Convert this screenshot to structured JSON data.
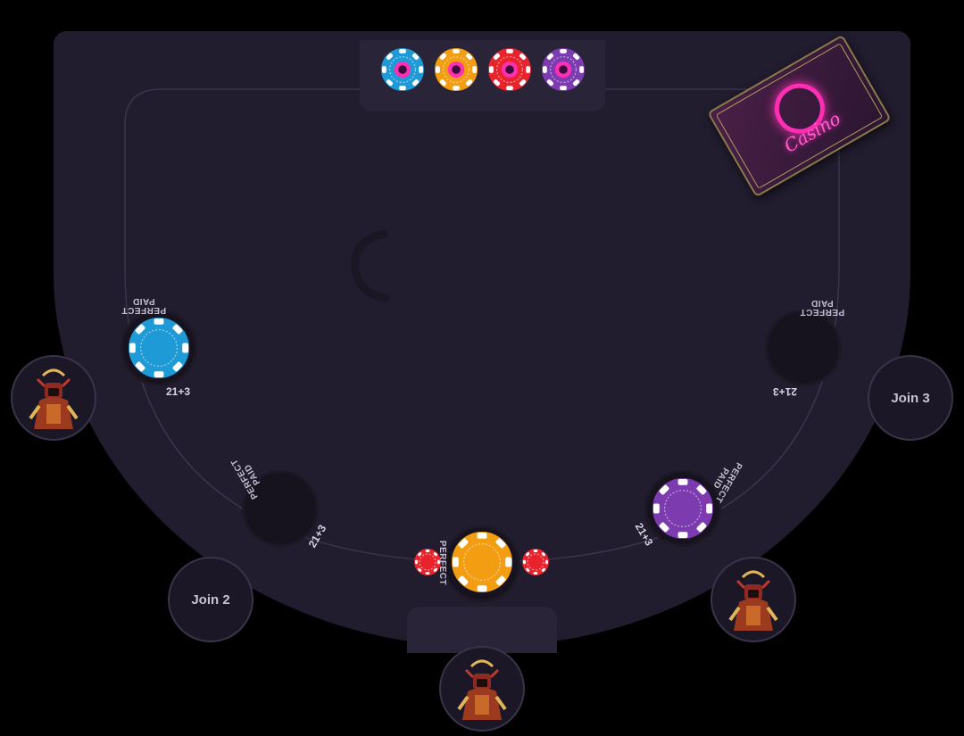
{
  "chip_tray": {
    "chips": [
      {
        "name": "chip-blue",
        "color": "#1e9ad6"
      },
      {
        "name": "chip-gold",
        "color": "#f29d12"
      },
      {
        "name": "chip-red",
        "color": "#e8232c"
      },
      {
        "name": "chip-purple",
        "color": "#7d3bb0"
      }
    ]
  },
  "seats": [
    {
      "position": "left",
      "state": "occupied",
      "avatar": "samurai-avatar"
    },
    {
      "position": "lower-left",
      "state": "open",
      "join_label": "Join 2"
    },
    {
      "position": "bottom-center",
      "state": "occupied",
      "avatar": "samurai-avatar"
    },
    {
      "position": "lower-right",
      "state": "occupied",
      "avatar": "samurai-avatar"
    },
    {
      "position": "right",
      "state": "open",
      "join_label": "Join 3"
    }
  ],
  "side_bets": {
    "perfect_paid_label": "PERFECT\nPAID",
    "perfect_label": "PERFECT",
    "twentyone_plus_three_label": "21+3"
  },
  "bets": {
    "seat_left_chip_color": "#1e9ad6",
    "seat_center_chip_color": "#f29d12",
    "seat_center_side_chip_color": "#e8232c",
    "seat_lower_right_chip_color": "#7d3bb0"
  },
  "deck_card": {
    "brand_text": "Casino",
    "accent_color": "#ff2fb4"
  },
  "colors": {
    "table": "#211c2e",
    "tray": "#2a2439",
    "background": "#000000"
  }
}
